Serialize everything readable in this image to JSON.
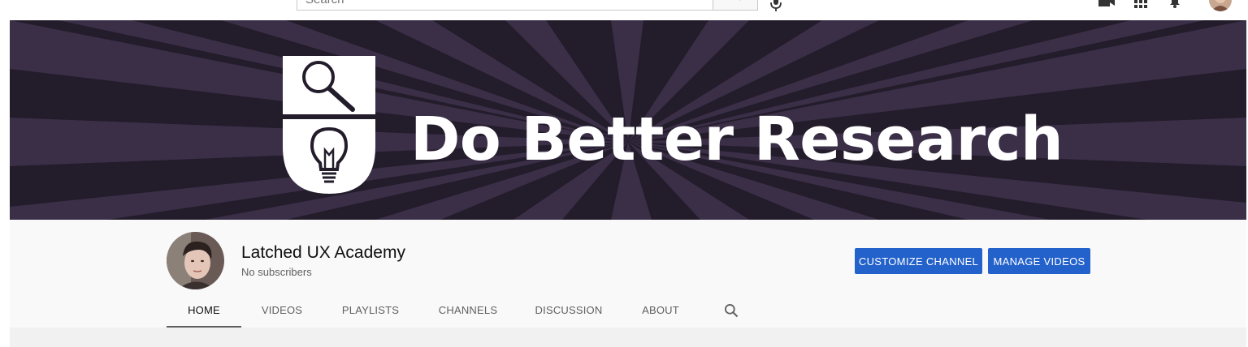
{
  "topbar": {
    "search_placeholder": "Search",
    "icons": [
      "search-icon",
      "microphone-icon",
      "create-video-icon",
      "apps-grid-icon",
      "notifications-bell-icon",
      "account-avatar"
    ]
  },
  "banner": {
    "title": "Do Better Research",
    "background_color": "#231c2b",
    "ray_color": "#3a2f47",
    "logo_icons": [
      "magnifier-icon",
      "lightbulb-icon"
    ]
  },
  "channel": {
    "name": "Latched UX Academy",
    "subscribers": "No subscribers",
    "buttons": {
      "customize": "CUSTOMIZE CHANNEL",
      "manage": "MANAGE VIDEOS"
    },
    "button_color": "#2462cb"
  },
  "tabs": [
    {
      "label": "HOME",
      "active": true
    },
    {
      "label": "VIDEOS",
      "active": false
    },
    {
      "label": "PLAYLISTS",
      "active": false
    },
    {
      "label": "CHANNELS",
      "active": false
    },
    {
      "label": "DISCUSSION",
      "active": false
    },
    {
      "label": "ABOUT",
      "active": false
    }
  ]
}
